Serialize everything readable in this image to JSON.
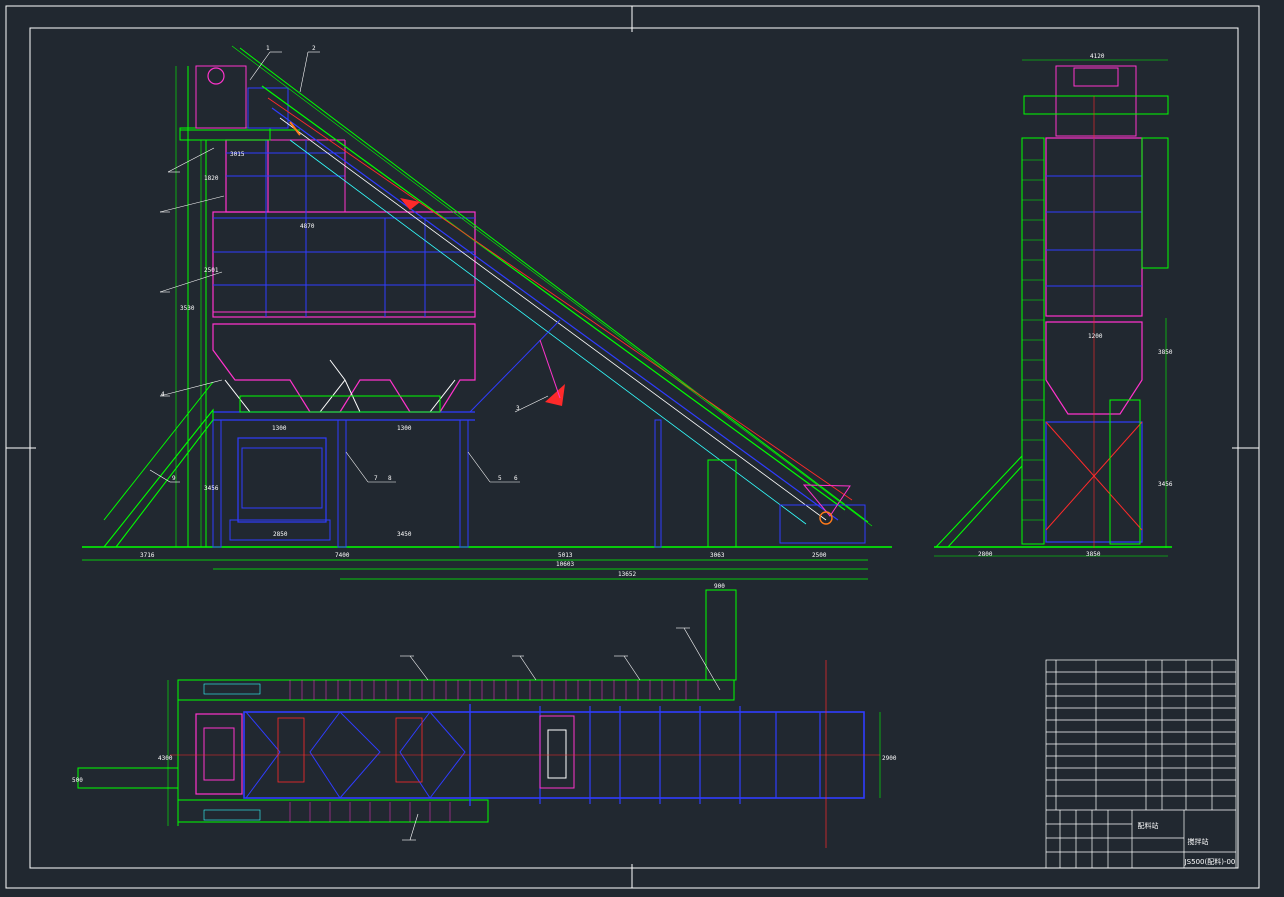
{
  "colors": {
    "background": "#212830",
    "border": "#ffffff",
    "structure": "#00ff00",
    "frame_blue": "#2f3cff",
    "frame_magenta": "#ff33cc",
    "cyan": "#33ffff",
    "red_axis": "#ff2a2a",
    "white_text": "#ffffff",
    "orange": "#ff7a1a",
    "dim_yellow": "#e6e600"
  },
  "front_view": {
    "dim_labels": [
      "3716",
      "7400",
      "5013",
      "3063",
      "2500",
      "10603",
      "13652",
      "1300",
      "1300",
      "2850",
      "3450",
      "3015",
      "4870",
      "1820",
      "2501",
      "3456",
      "3530"
    ],
    "part_callouts": [
      "1",
      "2",
      "3",
      "4",
      "5",
      "6",
      "7",
      "8",
      "9"
    ]
  },
  "side_view": {
    "dim_labels": [
      "4120",
      "1200",
      "2800",
      "3850",
      "3850",
      "3456"
    ]
  },
  "plan_view": {
    "dim_labels": [
      "900",
      "4300",
      "500",
      "2900"
    ]
  },
  "title_block": {
    "main_title": "配料站",
    "subtitle": "搅拌站",
    "drawing_number": "JS500(配料)-00"
  }
}
